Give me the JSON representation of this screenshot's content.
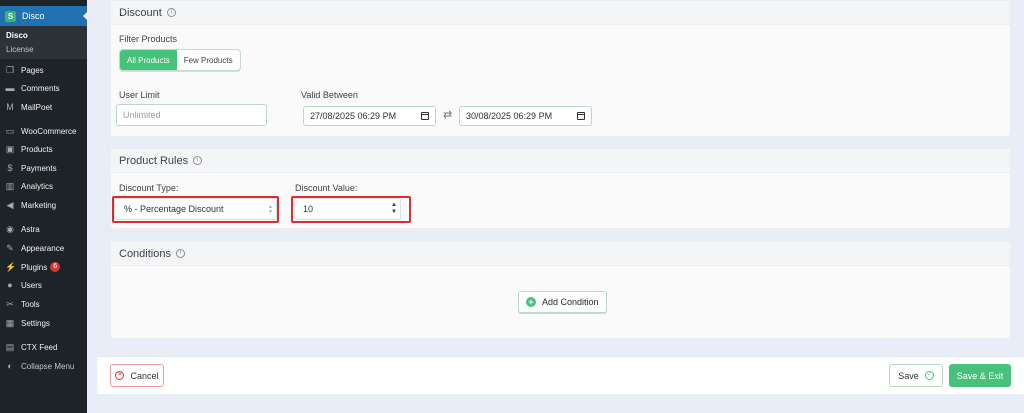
{
  "sidebar": {
    "active": {
      "logo": "S",
      "label": "Disco"
    },
    "submenu": {
      "current": "Disco",
      "license": "License"
    },
    "items": [
      {
        "label": "Pages",
        "icon": "pages-icon",
        "glyph": "❐"
      },
      {
        "label": "Comments",
        "icon": "comments-icon",
        "glyph": "▬"
      },
      {
        "label": "MailPoet",
        "icon": "mailpoet-icon",
        "glyph": "M"
      },
      {
        "label": "WooCommerce",
        "icon": "woocommerce-icon",
        "glyph": "▭"
      },
      {
        "label": "Products",
        "icon": "products-icon",
        "glyph": "▣"
      },
      {
        "label": "Payments",
        "icon": "payments-icon",
        "glyph": "$"
      },
      {
        "label": "Analytics",
        "icon": "analytics-icon",
        "glyph": "▥"
      },
      {
        "label": "Marketing",
        "icon": "marketing-icon",
        "glyph": "◀"
      },
      {
        "label": "Astra",
        "icon": "astra-icon",
        "glyph": "◉"
      },
      {
        "label": "Appearance",
        "icon": "appearance-icon",
        "glyph": "✎"
      },
      {
        "label": "Plugins",
        "icon": "plugins-icon",
        "glyph": "⚡",
        "badge": "6"
      },
      {
        "label": "Users",
        "icon": "users-icon",
        "glyph": "●"
      },
      {
        "label": "Tools",
        "icon": "tools-icon",
        "glyph": "✂"
      },
      {
        "label": "Settings",
        "icon": "settings-icon",
        "glyph": "▦"
      },
      {
        "label": "CTX Feed",
        "icon": "ctx-feed-icon",
        "glyph": "▤"
      },
      {
        "label": "Collapse Menu",
        "icon": "collapse-icon",
        "glyph": "◐"
      }
    ]
  },
  "discount": {
    "title": "Discount",
    "filter_label": "Filter Products",
    "filter_options": [
      "All Products",
      "Few Products"
    ],
    "user_limit_label": "User Limit",
    "user_limit_placeholder": "Unlimited",
    "valid_between_label": "Valid Between",
    "date_from": "27/08/2025 06:29 PM",
    "date_to": "30/08/2025 06:29 PM"
  },
  "product_rules": {
    "title": "Product Rules",
    "type_label": "Discount Type:",
    "type_value": "% - Percentage Discount",
    "value_label": "Discount Value:",
    "value": "10"
  },
  "conditions": {
    "title": "Conditions",
    "add_label": "Add Condition"
  },
  "footer": {
    "cancel": "Cancel",
    "save": "Save",
    "save_exit": "Save & Exit"
  },
  "colors": {
    "accent": "#46c27a",
    "sidebar_bg": "#1d2327",
    "sidebar_active": "#2271b1",
    "highlight": "#e02b2b"
  }
}
